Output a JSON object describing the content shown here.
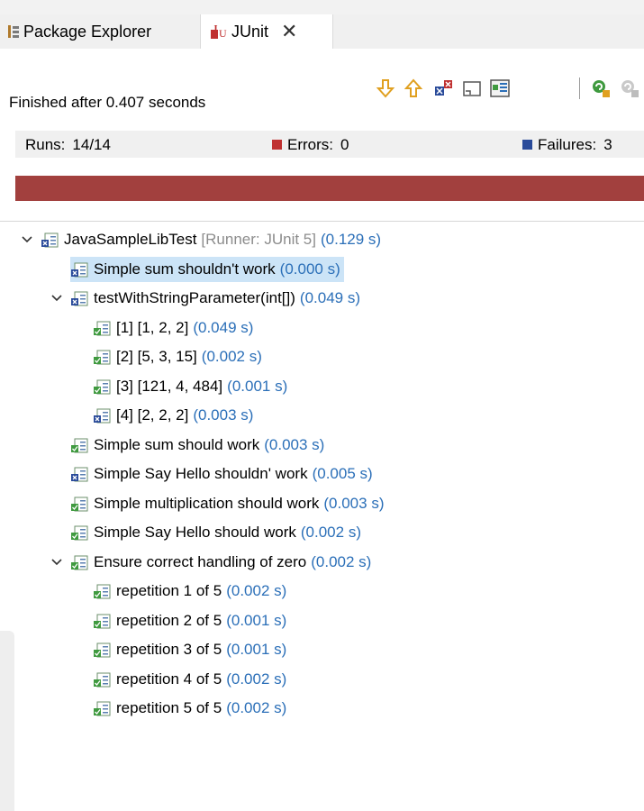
{
  "tabs": [
    {
      "label": "Package Explorer",
      "icon": "package-explorer-icon"
    },
    {
      "label": "JUnit",
      "icon": "junit-icon",
      "close": "✕"
    }
  ],
  "toolbar": [
    "next-failure-icon",
    "previous-failure-icon",
    "show-failures-only-icon",
    "scroll-lock-icon",
    "layout-icon",
    "rerun-test-icon",
    "rerun-failed-icon"
  ],
  "status": "Finished after 0.407 seconds",
  "counters": {
    "runs_label": "Runs:",
    "runs_value": "14/14",
    "errors_label": "Errors:",
    "errors_value": "0",
    "failures_label": "Failures:",
    "failures_value": "3"
  },
  "progress": {
    "state": "failed",
    "color": "#a2403e"
  },
  "tree": [
    {
      "label": "JavaSampleLibTest",
      "runner": "[Runner: JUnit 5]",
      "time": "(0.129 s)",
      "status": "failed",
      "level": 0,
      "expanded": true
    },
    {
      "label": "Simple sum shouldn't work",
      "time": "(0.000 s)",
      "status": "failed",
      "level": 1,
      "selected": true
    },
    {
      "label": "testWithStringParameter(int[])",
      "time": "(0.049 s)",
      "status": "failed",
      "level": 1,
      "expanded": true
    },
    {
      "label": "[1] [1, 2, 2]",
      "time": "(0.049 s)",
      "status": "passed",
      "level": 2
    },
    {
      "label": "[2] [5, 3, 15]",
      "time": "(0.002 s)",
      "status": "passed",
      "level": 2
    },
    {
      "label": "[3] [121, 4, 484]",
      "time": "(0.001 s)",
      "status": "passed",
      "level": 2
    },
    {
      "label": "[4] [2, 2, 2]",
      "time": "(0.003 s)",
      "status": "failed",
      "level": 2
    },
    {
      "label": "Simple sum should work",
      "time": "(0.003 s)",
      "status": "passed",
      "level": 1
    },
    {
      "label": "Simple Say Hello shouldn' work",
      "time": "(0.005 s)",
      "status": "failed",
      "level": 1
    },
    {
      "label": "Simple multiplication should work",
      "time": "(0.003 s)",
      "status": "passed",
      "level": 1
    },
    {
      "label": "Simple Say Hello should work",
      "time": "(0.002 s)",
      "status": "passed",
      "level": 1
    },
    {
      "label": "Ensure correct handling of zero",
      "time": "(0.002 s)",
      "status": "passed",
      "level": 1,
      "expanded": true
    },
    {
      "label": "repetition 1 of 5",
      "time": "(0.002 s)",
      "status": "passed",
      "level": 2
    },
    {
      "label": "repetition 2 of 5",
      "time": "(0.001 s)",
      "status": "passed",
      "level": 2
    },
    {
      "label": "repetition 3 of 5",
      "time": "(0.001 s)",
      "status": "passed",
      "level": 2
    },
    {
      "label": "repetition 4 of 5",
      "time": "(0.002 s)",
      "status": "passed",
      "level": 2
    },
    {
      "label": "repetition 5 of 5",
      "time": "(0.002 s)",
      "status": "passed",
      "level": 2
    }
  ],
  "colors": {
    "time": "#2b6fb8",
    "selected": "#cce4f7",
    "passed": "#3f9a3f",
    "failed": "#2a4b9a"
  }
}
